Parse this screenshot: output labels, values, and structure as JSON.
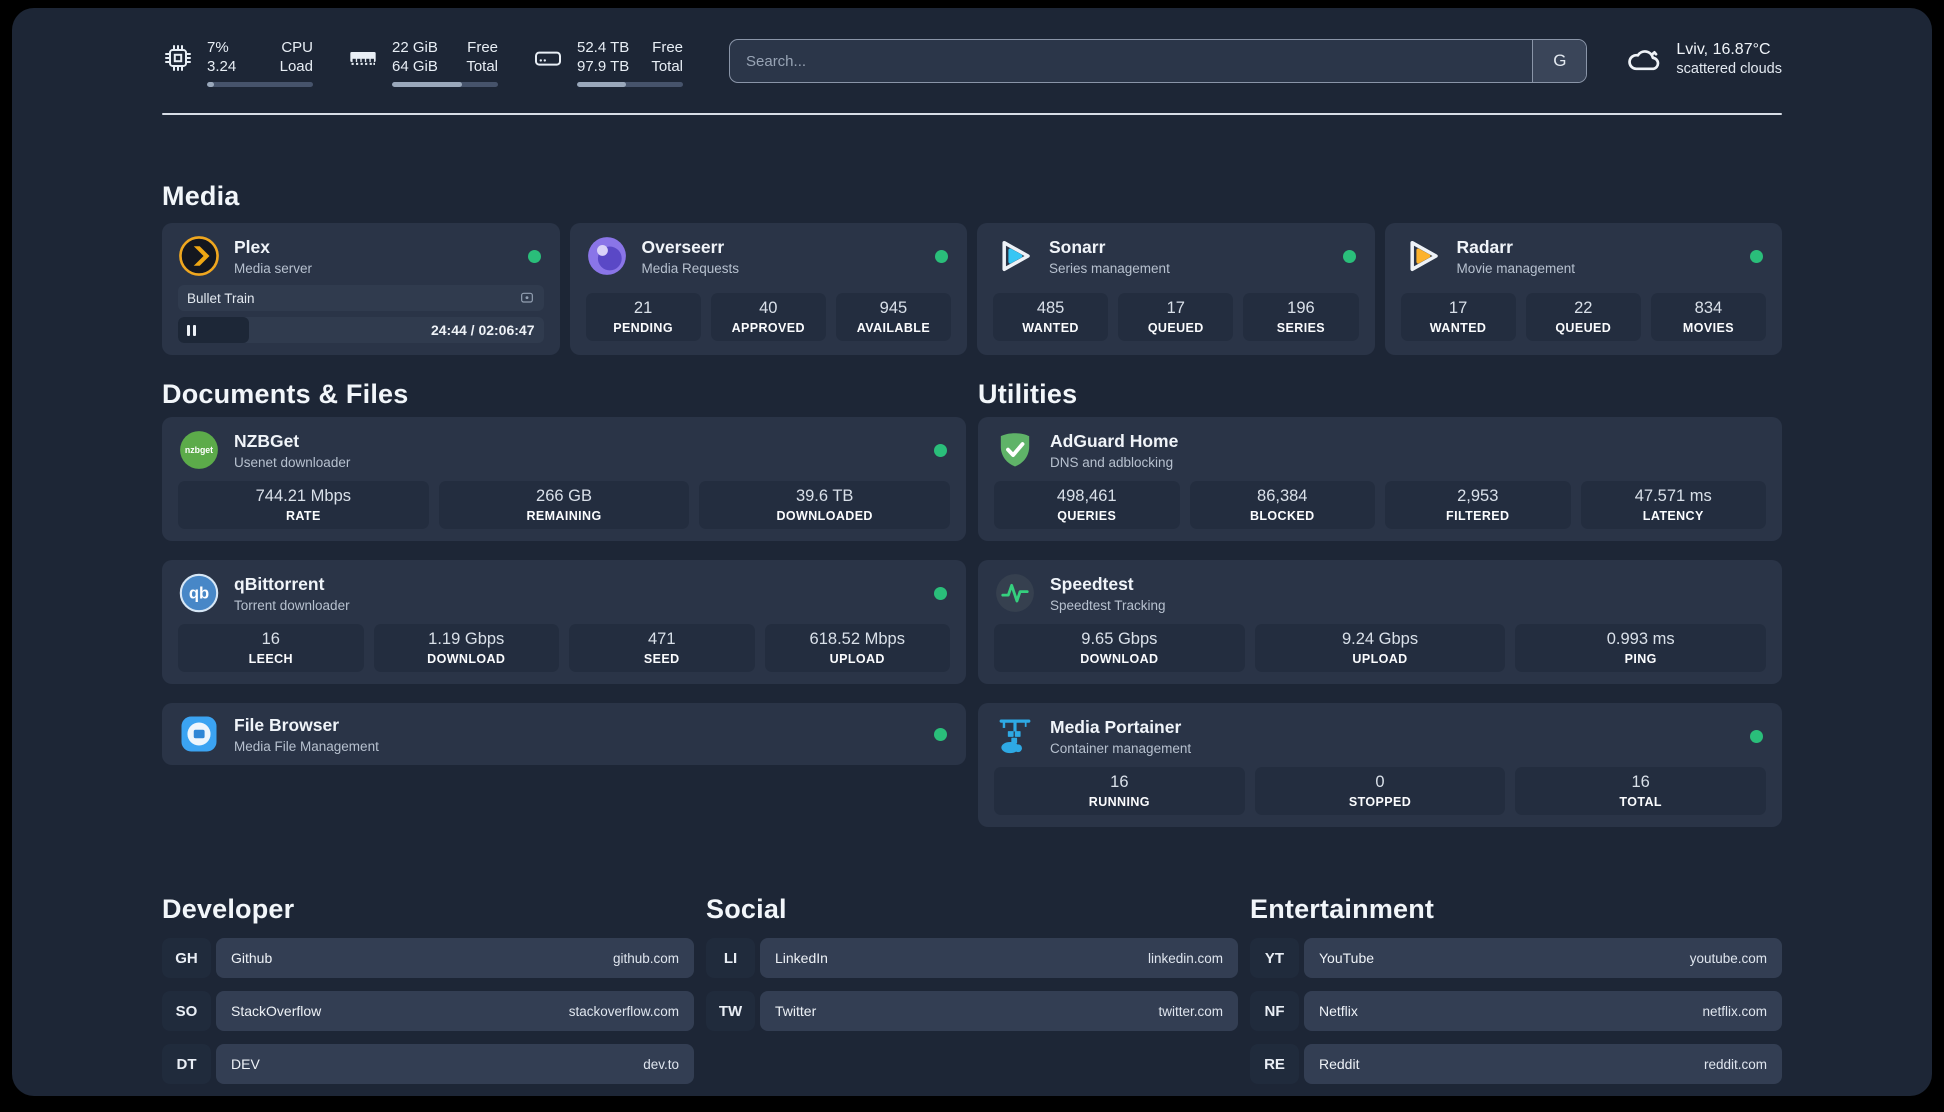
{
  "header": {
    "metrics": [
      {
        "icon": "cpu-icon",
        "col1": [
          "7%",
          "3.24"
        ],
        "col2": [
          "CPU",
          "Load"
        ],
        "progress_pct": 7
      },
      {
        "icon": "ram-icon",
        "col1": [
          "22 GiB",
          "64 GiB"
        ],
        "col2": [
          "Free",
          "Total"
        ],
        "progress_pct": 66
      },
      {
        "icon": "disk-icon",
        "col1": [
          "52.4 TB",
          "97.9 TB"
        ],
        "col2": [
          "Free",
          "Total"
        ],
        "progress_pct": 46
      }
    ],
    "search": {
      "placeholder": "Search...",
      "engine_button": "G"
    },
    "weather": {
      "icon": "cloud-icon",
      "location": "Lviv, 16.87°C",
      "condition": "scattered clouds"
    }
  },
  "sections": {
    "media": {
      "title": "Media",
      "plex": {
        "title": "Plex",
        "subtitle": "Media server",
        "online": true,
        "now_playing": {
          "title": "Bullet Train",
          "state": "paused",
          "time": "24:44 / 02:06:47",
          "progress_pct": 19.5
        }
      },
      "overseerr": {
        "title": "Overseerr",
        "subtitle": "Media Requests",
        "online": true,
        "stats": [
          {
            "value": "21",
            "label": "PENDING"
          },
          {
            "value": "40",
            "label": "APPROVED"
          },
          {
            "value": "945",
            "label": "AVAILABLE"
          }
        ]
      },
      "sonarr": {
        "title": "Sonarr",
        "subtitle": "Series management",
        "online": true,
        "stats": [
          {
            "value": "485",
            "label": "WANTED"
          },
          {
            "value": "17",
            "label": "QUEUED"
          },
          {
            "value": "196",
            "label": "SERIES"
          }
        ]
      },
      "radarr": {
        "title": "Radarr",
        "subtitle": "Movie management",
        "online": true,
        "stats": [
          {
            "value": "17",
            "label": "WANTED"
          },
          {
            "value": "22",
            "label": "QUEUED"
          },
          {
            "value": "834",
            "label": "MOVIES"
          }
        ]
      }
    },
    "documents": {
      "title": "Documents & Files",
      "nzbget": {
        "title": "NZBGet",
        "subtitle": "Usenet downloader",
        "online": true,
        "stats": [
          {
            "value": "744.21 Mbps",
            "label": "RATE"
          },
          {
            "value": "266 GB",
            "label": "REMAINING"
          },
          {
            "value": "39.6 TB",
            "label": "DOWNLOADED"
          }
        ]
      },
      "qbittorrent": {
        "title": "qBittorrent",
        "subtitle": "Torrent downloader",
        "online": true,
        "stats": [
          {
            "value": "16",
            "label": "LEECH"
          },
          {
            "value": "1.19 Gbps",
            "label": "DOWNLOAD"
          },
          {
            "value": "471",
            "label": "SEED"
          },
          {
            "value": "618.52 Mbps",
            "label": "UPLOAD"
          }
        ]
      },
      "filebrowser": {
        "title": "File Browser",
        "subtitle": "Media File Management",
        "online": true
      }
    },
    "utilities": {
      "title": "Utilities",
      "adguard": {
        "title": "AdGuard Home",
        "subtitle": "DNS and adblocking",
        "stats": [
          {
            "value": "498,461",
            "label": "QUERIES"
          },
          {
            "value": "86,384",
            "label": "BLOCKED"
          },
          {
            "value": "2,953",
            "label": "FILTERED"
          },
          {
            "value": "47.571 ms",
            "label": "LATENCY"
          }
        ]
      },
      "speedtest": {
        "title": "Speedtest",
        "subtitle": "Speedtest Tracking",
        "stats": [
          {
            "value": "9.65 Gbps",
            "label": "DOWNLOAD"
          },
          {
            "value": "9.24 Gbps",
            "label": "UPLOAD"
          },
          {
            "value": "0.993 ms",
            "label": "PING"
          }
        ]
      },
      "portainer": {
        "title": "Media Portainer",
        "subtitle": "Container management",
        "online": true,
        "stats": [
          {
            "value": "16",
            "label": "RUNNING"
          },
          {
            "value": "0",
            "label": "STOPPED"
          },
          {
            "value": "16",
            "label": "TOTAL"
          }
        ]
      }
    },
    "bookmarks": [
      {
        "title": "Developer",
        "items": [
          {
            "abbr": "GH",
            "name": "Github",
            "url": "github.com"
          },
          {
            "abbr": "SO",
            "name": "StackOverflow",
            "url": "stackoverflow.com"
          },
          {
            "abbr": "DT",
            "name": "DEV",
            "url": "dev.to"
          }
        ]
      },
      {
        "title": "Social",
        "items": [
          {
            "abbr": "LI",
            "name": "LinkedIn",
            "url": "linkedin.com"
          },
          {
            "abbr": "TW",
            "name": "Twitter",
            "url": "twitter.com"
          }
        ]
      },
      {
        "title": "Entertainment",
        "items": [
          {
            "abbr": "YT",
            "name": "YouTube",
            "url": "youtube.com"
          },
          {
            "abbr": "NF",
            "name": "Netflix",
            "url": "netflix.com"
          },
          {
            "abbr": "RE",
            "name": "Reddit",
            "url": "reddit.com"
          }
        ]
      }
    ]
  },
  "colors": {
    "status_online": "#2abe7a",
    "plex_amber": "#efa713",
    "sonarr_blue": "#36c6f4",
    "radarr_amber": "#fdb22c",
    "nzbget_green": "#5cab4a",
    "qbittorrent_blue": "#4787c7",
    "filebrowser_blue": "#3ba3f2",
    "adguard_green": "#5fb368",
    "speedtest_green": "#35d07e",
    "portainer_blue": "#2ea9e4",
    "overseerr_purple": "#8a75e8"
  }
}
